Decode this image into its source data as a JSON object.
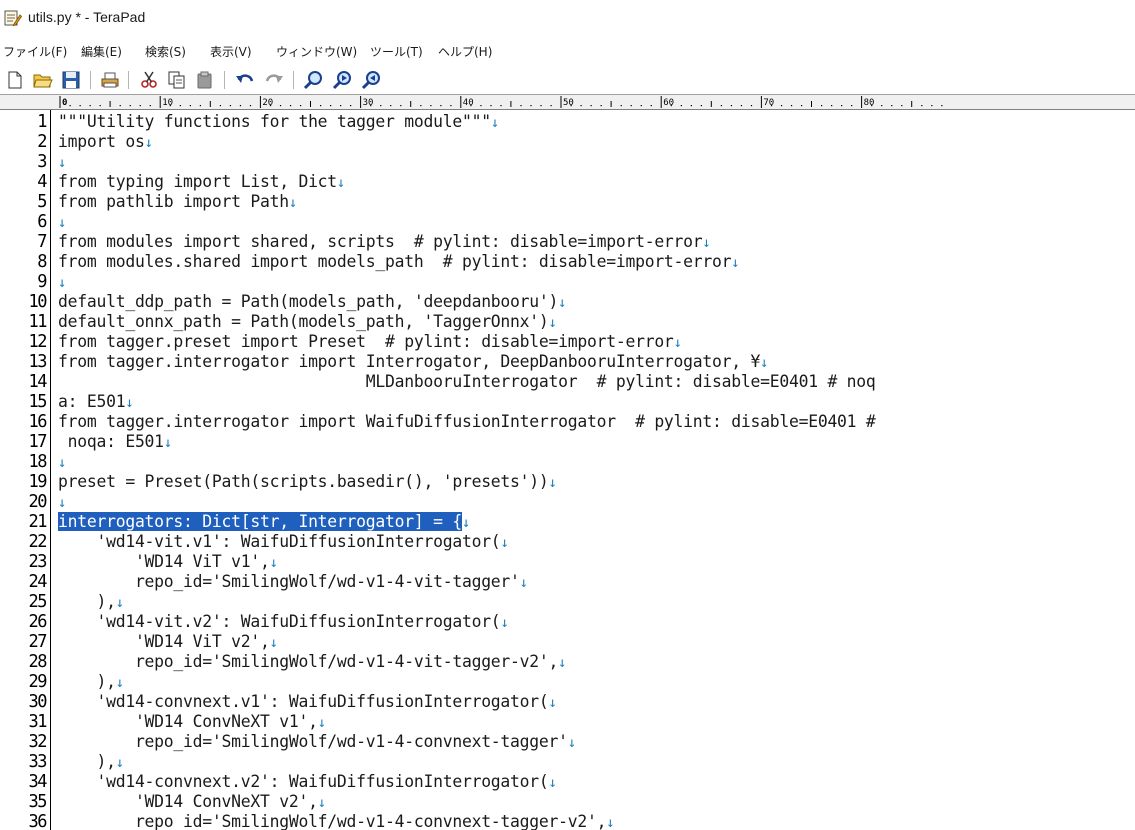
{
  "window": {
    "title": "utils.py * - TeraPad"
  },
  "menu": [
    {
      "label": "ファイル(F)"
    },
    {
      "label": "編集(E)"
    },
    {
      "label": "検索(S)"
    },
    {
      "label": "表示(V)"
    },
    {
      "label": "ウィンドウ(W)"
    },
    {
      "label": "ツール(T)"
    },
    {
      "label": "ヘルプ(H)"
    }
  ],
  "toolbar": [
    {
      "icon": "new-file-icon"
    },
    {
      "icon": "open-folder-icon"
    },
    {
      "icon": "save-icon"
    },
    {
      "icon": "print-icon"
    },
    {
      "icon": "cut-icon"
    },
    {
      "icon": "copy-icon"
    },
    {
      "icon": "paste-icon"
    },
    {
      "icon": "undo-icon"
    },
    {
      "icon": "redo-icon"
    },
    {
      "icon": "find-icon"
    },
    {
      "icon": "find-next-icon"
    },
    {
      "icon": "find-prev-icon"
    }
  ],
  "ruler": {
    "labels": [
      "0",
      "10",
      "20",
      "30",
      "40",
      "50",
      "60",
      "70",
      "80"
    ]
  },
  "editor": {
    "eol_marker": "↓",
    "selection_color": "#1f5fbd",
    "eol_color": "#1e7fbf",
    "lines": [
      {
        "n": "1",
        "text": "\"\"\"Utility functions for the tagger module\"\"\"",
        "eol": true
      },
      {
        "n": "2",
        "text": "import os",
        "eol": true
      },
      {
        "n": "3",
        "text": "",
        "eol": true
      },
      {
        "n": "4",
        "text": "from typing import List, Dict",
        "eol": true
      },
      {
        "n": "5",
        "text": "from pathlib import Path",
        "eol": true
      },
      {
        "n": "6",
        "text": "",
        "eol": true
      },
      {
        "n": "7",
        "text": "from modules import shared, scripts  # pylint: disable=import-error",
        "eol": true
      },
      {
        "n": "8",
        "text": "from modules.shared import models_path  # pylint: disable=import-error",
        "eol": true
      },
      {
        "n": "9",
        "text": "",
        "eol": true
      },
      {
        "n": "10",
        "text": "default_ddp_path = Path(models_path, 'deepdanbooru')",
        "eol": true
      },
      {
        "n": "11",
        "text": "default_onnx_path = Path(models_path, 'TaggerOnnx')",
        "eol": true
      },
      {
        "n": "12",
        "text": "from tagger.preset import Preset  # pylint: disable=import-error",
        "eol": true
      },
      {
        "n": "13",
        "text": "from tagger.interrogator import Interrogator, DeepDanbooruInterrogator, ¥",
        "eol": true
      },
      {
        "n": "14",
        "text": "                                MLDanbooruInterrogator  # pylint: disable=E0401 # noq",
        "eol": false
      },
      {
        "n": "15",
        "text": "a: E501",
        "eol": true
      },
      {
        "n": "16",
        "text": "from tagger.interrogator import WaifuDiffusionInterrogator  # pylint: disable=E0401 #",
        "eol": false
      },
      {
        "n": "17",
        "text": " noqa: E501",
        "eol": true
      },
      {
        "n": "18",
        "text": "",
        "eol": true
      },
      {
        "n": "19",
        "text": "preset = Preset(Path(scripts.basedir(), 'presets'))",
        "eol": true
      },
      {
        "n": "20",
        "text": "",
        "eol": true
      },
      {
        "n": "21",
        "text": "interrogators: Dict[str, Interrogator] = {",
        "eol": true,
        "selected": true
      },
      {
        "n": "22",
        "text": "    'wd14-vit.v1': WaifuDiffusionInterrogator(",
        "eol": true
      },
      {
        "n": "23",
        "text": "        'WD14 ViT v1',",
        "eol": true
      },
      {
        "n": "24",
        "text": "        repo_id='SmilingWolf/wd-v1-4-vit-tagger'",
        "eol": true
      },
      {
        "n": "25",
        "text": "    ),",
        "eol": true
      },
      {
        "n": "26",
        "text": "    'wd14-vit.v2': WaifuDiffusionInterrogator(",
        "eol": true
      },
      {
        "n": "27",
        "text": "        'WD14 ViT v2',",
        "eol": true
      },
      {
        "n": "28",
        "text": "        repo_id='SmilingWolf/wd-v1-4-vit-tagger-v2',",
        "eol": true
      },
      {
        "n": "29",
        "text": "    ),",
        "eol": true
      },
      {
        "n": "30",
        "text": "    'wd14-convnext.v1': WaifuDiffusionInterrogator(",
        "eol": true
      },
      {
        "n": "31",
        "text": "        'WD14 ConvNeXT v1',",
        "eol": true
      },
      {
        "n": "32",
        "text": "        repo_id='SmilingWolf/wd-v1-4-convnext-tagger'",
        "eol": true
      },
      {
        "n": "33",
        "text": "    ),",
        "eol": true
      },
      {
        "n": "34",
        "text": "    'wd14-convnext.v2': WaifuDiffusionInterrogator(",
        "eol": true
      },
      {
        "n": "35",
        "text": "        'WD14 ConvNeXT v2',",
        "eol": true
      },
      {
        "n": "36",
        "text": "        repo_id='SmilingWolf/wd-v1-4-convnext-tagger-v2',",
        "eol": true
      }
    ]
  }
}
